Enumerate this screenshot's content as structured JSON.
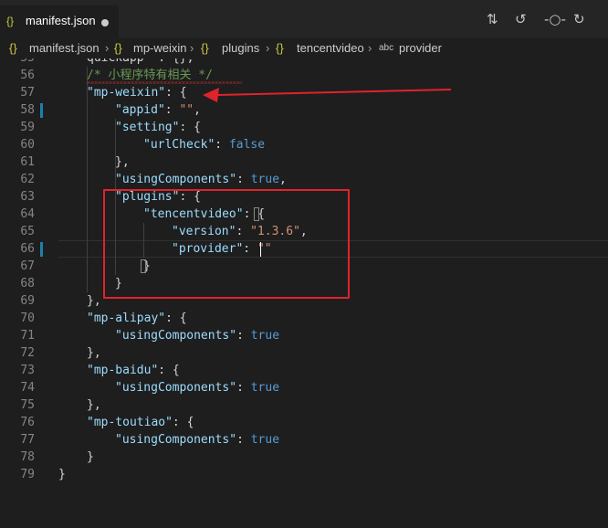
{
  "tab": {
    "icon": "{}",
    "title": "manifest.json",
    "modified": true
  },
  "toolbar": {
    "icons": [
      "open-changes-icon",
      "go-back-icon",
      "commit-dot-icon",
      "go-forward-icon",
      "more-actions-icon"
    ]
  },
  "breadcrumbs": [
    {
      "kind": "brace",
      "icon": "{}",
      "label": "manifest.json"
    },
    {
      "kind": "brace",
      "icon": "{}",
      "label": "mp-weixin"
    },
    {
      "kind": "brace",
      "icon": "{}",
      "label": "plugins"
    },
    {
      "kind": "brace",
      "icon": "{}",
      "label": "tencentvideo"
    },
    {
      "kind": "abc",
      "icon": "abc",
      "label": "provider"
    }
  ],
  "editor": {
    "lines": [
      {
        "n": "55",
        "indent": 1,
        "parts": [
          [
            "p",
            "quickapp\" : {},"
          ]
        ]
      },
      {
        "n": "56",
        "indent": 1,
        "parts": [
          [
            "c",
            "/* 小程序特有相关 */"
          ]
        ]
      },
      {
        "n": "57",
        "indent": 1,
        "parts": [
          [
            "k",
            "\"mp-weixin\""
          ],
          [
            "p",
            ": {"
          ]
        ]
      },
      {
        "n": "58",
        "indent": 2,
        "parts": [
          [
            "k",
            "\"appid\""
          ],
          [
            "p",
            ": "
          ],
          [
            "s",
            "\"\""
          ],
          [
            "p",
            ","
          ]
        ]
      },
      {
        "n": "59",
        "indent": 2,
        "parts": [
          [
            "k",
            "\"setting\""
          ],
          [
            "p",
            ": {"
          ]
        ]
      },
      {
        "n": "60",
        "indent": 3,
        "parts": [
          [
            "k",
            "\"urlCheck\""
          ],
          [
            "p",
            ": "
          ],
          [
            "b",
            "false"
          ]
        ]
      },
      {
        "n": "61",
        "indent": 2,
        "parts": [
          [
            "p",
            "},"
          ]
        ]
      },
      {
        "n": "62",
        "indent": 2,
        "parts": [
          [
            "k",
            "\"usingComponents\""
          ],
          [
            "p",
            ": "
          ],
          [
            "b",
            "true"
          ],
          [
            "p",
            ","
          ]
        ]
      },
      {
        "n": "63",
        "indent": 2,
        "parts": [
          [
            "k",
            "\"plugins\""
          ],
          [
            "p",
            ": {"
          ]
        ]
      },
      {
        "n": "64",
        "indent": 3,
        "parts": [
          [
            "k",
            "\"tencentvideo\""
          ],
          [
            "p",
            ": {"
          ]
        ]
      },
      {
        "n": "65",
        "indent": 4,
        "parts": [
          [
            "k",
            "\"version\""
          ],
          [
            "p",
            ": "
          ],
          [
            "s",
            "\"1.3.6\""
          ],
          [
            "p",
            ","
          ]
        ]
      },
      {
        "n": "66",
        "indent": 4,
        "parts": [
          [
            "k",
            "\"provider\""
          ],
          [
            "p",
            ": "
          ],
          [
            "s",
            "\"\""
          ]
        ]
      },
      {
        "n": "67",
        "indent": 3,
        "parts": [
          [
            "p",
            "}"
          ]
        ]
      },
      {
        "n": "68",
        "indent": 2,
        "parts": [
          [
            "p",
            "}"
          ]
        ]
      },
      {
        "n": "69",
        "indent": 1,
        "parts": [
          [
            "p",
            "},"
          ]
        ]
      },
      {
        "n": "70",
        "indent": 1,
        "parts": [
          [
            "k",
            "\"mp-alipay\""
          ],
          [
            "p",
            ": {"
          ]
        ]
      },
      {
        "n": "71",
        "indent": 2,
        "parts": [
          [
            "k",
            "\"usingComponents\""
          ],
          [
            "p",
            ": "
          ],
          [
            "b",
            "true"
          ]
        ]
      },
      {
        "n": "72",
        "indent": 1,
        "parts": [
          [
            "p",
            "},"
          ]
        ]
      },
      {
        "n": "73",
        "indent": 1,
        "parts": [
          [
            "k",
            "\"mp-baidu\""
          ],
          [
            "p",
            ": {"
          ]
        ]
      },
      {
        "n": "74",
        "indent": 2,
        "parts": [
          [
            "k",
            "\"usingComponents\""
          ],
          [
            "p",
            ": "
          ],
          [
            "b",
            "true"
          ]
        ]
      },
      {
        "n": "75",
        "indent": 1,
        "parts": [
          [
            "p",
            "},"
          ]
        ]
      },
      {
        "n": "76",
        "indent": 1,
        "parts": [
          [
            "k",
            "\"mp-toutiao\""
          ],
          [
            "p",
            ": {"
          ]
        ]
      },
      {
        "n": "77",
        "indent": 2,
        "parts": [
          [
            "k",
            "\"usingComponents\""
          ],
          [
            "p",
            ": "
          ],
          [
            "b",
            "true"
          ]
        ]
      },
      {
        "n": "78",
        "indent": 1,
        "parts": [
          [
            "p",
            "}"
          ]
        ]
      },
      {
        "n": "79",
        "indent": 0,
        "parts": [
          [
            "p",
            "}"
          ]
        ]
      }
    ],
    "modified_lines": [
      "58",
      "66"
    ],
    "cursor_line": "66"
  },
  "annotations": {
    "highlight_color": "#e0232b"
  },
  "colors": {
    "key": "#9cdcfe",
    "string": "#ce9178",
    "keyword": "#569cd6",
    "comment": "#6a9955",
    "background": "#1e1e1e"
  }
}
